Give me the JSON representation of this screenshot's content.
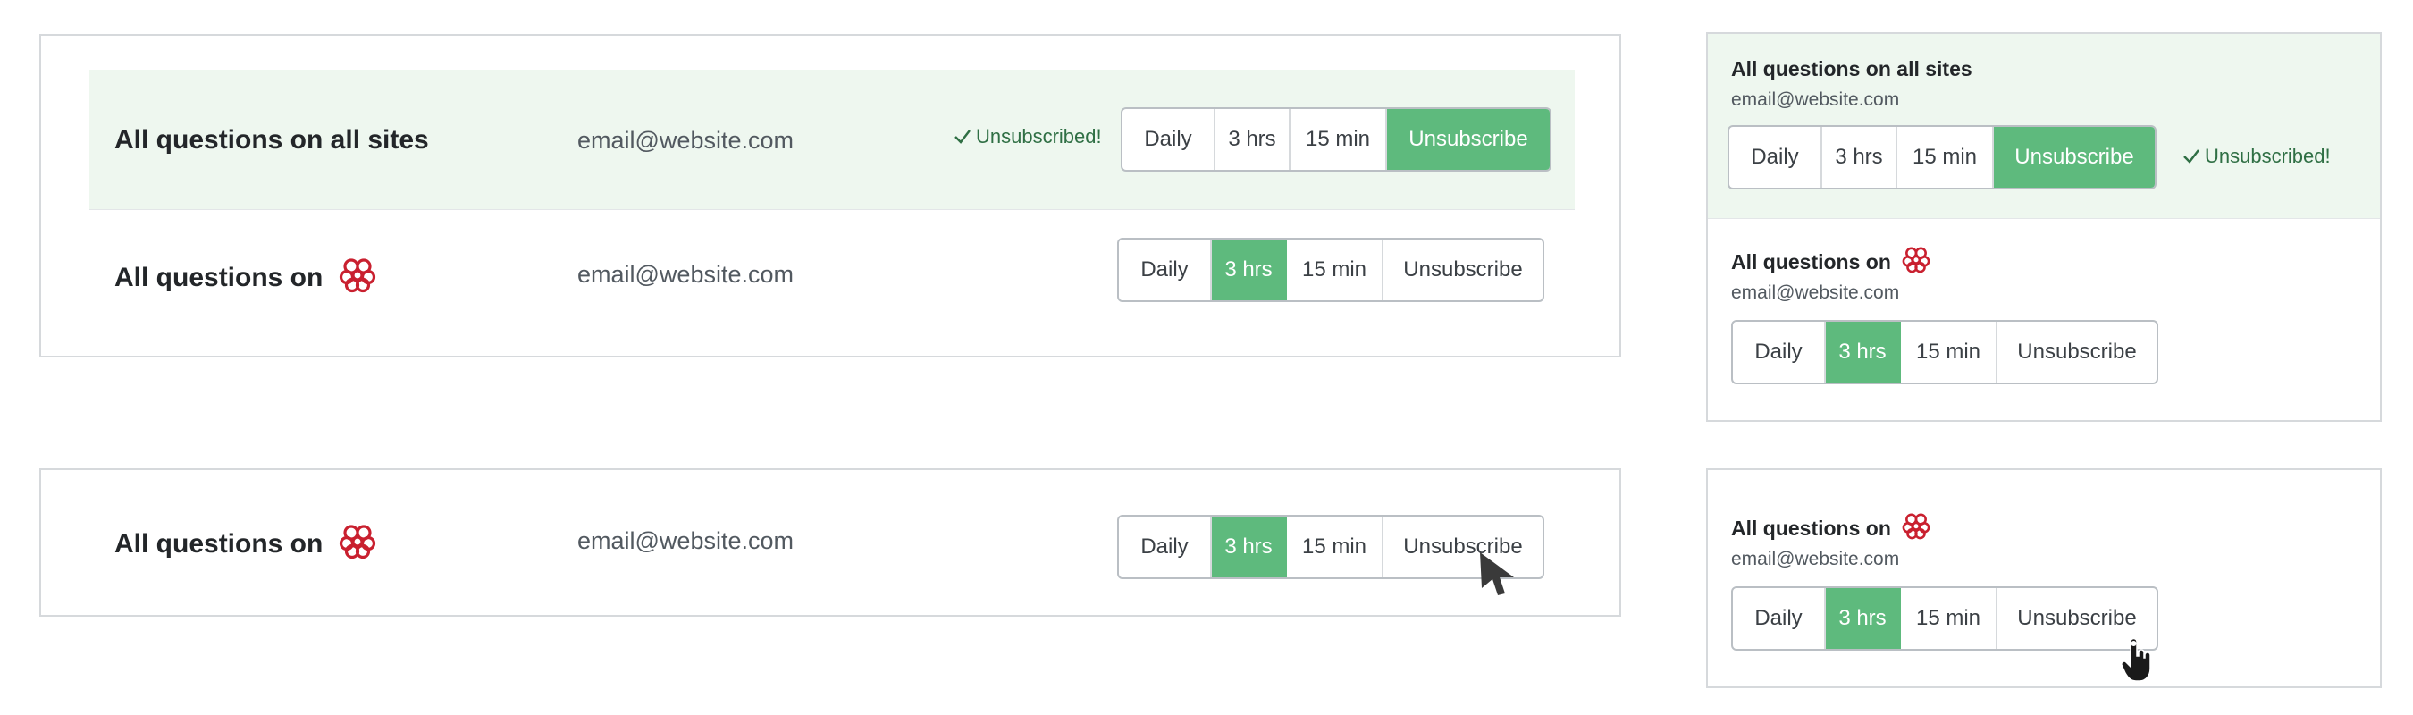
{
  "labels": {
    "title_all_sites": "All questions on all sites",
    "title_on": "All questions on",
    "email": "email@website.com",
    "unsubscribed": "Unsubscribed!"
  },
  "frequency_options": [
    "Daily",
    "3 hrs",
    "15 min",
    "Unsubscribe"
  ],
  "variants": {
    "wide_list": {
      "rows": [
        {
          "selected": "Unsubscribe",
          "status_visible": true
        },
        {
          "selected": "3 hrs",
          "status_visible": false
        }
      ]
    },
    "wide_single": {
      "selected": "3 hrs",
      "pointer": "arrow-cursor-icon"
    },
    "narrow_list": {
      "rows": [
        {
          "selected": "Unsubscribe",
          "status_visible": true
        },
        {
          "selected": "3 hrs",
          "status_visible": false
        }
      ]
    },
    "narrow_single": {
      "selected": "3 hrs",
      "pointer": "hand-cursor-icon"
    }
  },
  "colors": {
    "selected_bg": "#5eba7d",
    "success_row_bg": "#eef7ef",
    "success_text": "#2f6f44",
    "border": "#babfc4",
    "logo": "#c9202f"
  },
  "icons": {
    "site_logo": "brain-logo-icon",
    "status": "checkmark-icon"
  }
}
